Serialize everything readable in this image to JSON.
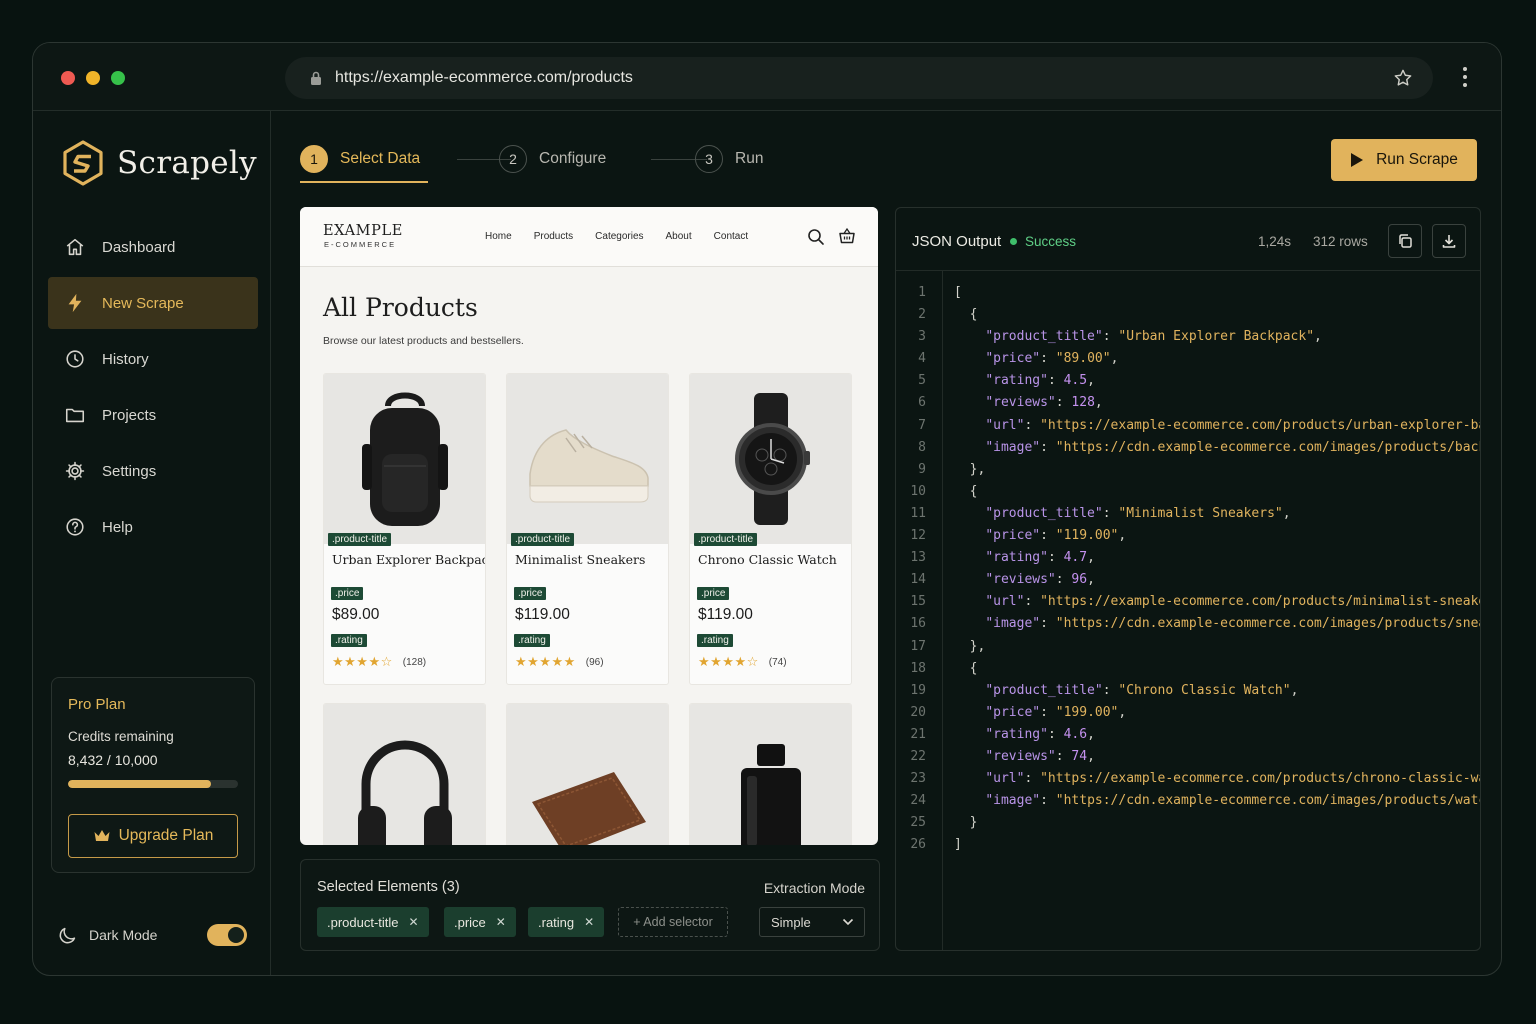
{
  "browser": {
    "url": "https://example-ecommerce.com/products"
  },
  "app": {
    "name": "Scrapely"
  },
  "sidebar": {
    "items": [
      {
        "label": "Dashboard",
        "icon": "home-icon"
      },
      {
        "label": "New Scrape",
        "icon": "bolt-icon",
        "active": true
      },
      {
        "label": "History",
        "icon": "clock-icon"
      },
      {
        "label": "Projects",
        "icon": "folder-icon"
      },
      {
        "label": "Settings",
        "icon": "gear-icon"
      },
      {
        "label": "Help",
        "icon": "help-icon"
      }
    ],
    "plan": {
      "title": "Pro Plan",
      "credits_label": "Credits remaining",
      "credits_value": "8,432 / 10,000",
      "credits_fraction": 0.8432,
      "upgrade_label": "Upgrade Plan"
    },
    "dark_mode": {
      "label": "Dark Mode",
      "on": true
    }
  },
  "steps": [
    {
      "num": "1",
      "label": "Select Data",
      "active": true
    },
    {
      "num": "2",
      "label": "Configure"
    },
    {
      "num": "3",
      "label": "Run"
    }
  ],
  "run_button": "Run Scrape",
  "preview": {
    "brand": "EXAMPLE",
    "brand_sub": "E-COMMERCE",
    "nav": [
      "Home",
      "Products",
      "Categories",
      "About",
      "Contact"
    ],
    "title": "All Products",
    "subtitle": "Browse our latest products and bestsellers.",
    "tags": {
      "title": ".product-title",
      "price": ".price",
      "rating": ".rating"
    },
    "products": [
      {
        "name": "Urban Explorer Backpack",
        "price": "$89.00",
        "reviews": "(128)",
        "rating": 4.5,
        "image": "backpack"
      },
      {
        "name": "Minimalist Sneakers",
        "price": "$119.00",
        "reviews": "(96)",
        "rating": 4.7,
        "image": "sneaker"
      },
      {
        "name": "Chrono Classic Watch",
        "price": "$119.00",
        "reviews": "(74)",
        "rating": 4.6,
        "image": "watch"
      }
    ],
    "more_products": [
      "headphones",
      "wallet",
      "perfume"
    ]
  },
  "selection": {
    "title": "Selected Elements (3)",
    "chips": [
      ".product-title",
      ".price",
      ".rating"
    ],
    "add_label": "+ Add selector",
    "mode_label": "Extraction Mode",
    "mode_value": "Simple"
  },
  "json_panel": {
    "title": "JSON Output",
    "status": "Success",
    "time": "1,24s",
    "rows": "312 rows",
    "colors": {
      "key": "#b994e8",
      "string": "#e0b35e",
      "status": "#5fcf86"
    },
    "records": [
      {
        "product_title": "Urban Explorer Backpack",
        "price": "89.00",
        "rating": "4.5",
        "reviews": "128",
        "url": "https://example-ecommerce.com/products/urban-explorer-backpack",
        "image": "https://cdn.example-ecommerce.com/images/products/backpack.jpg"
      },
      {
        "product_title": "Minimalist Sneakers",
        "price": "119.00",
        "rating": "4.7",
        "reviews": "96",
        "url": "https://example-ecommerce.com/products/minimalist-sneakers",
        "image": "https://cdn.example-ecommerce.com/images/products/sneakers.jpg"
      },
      {
        "product_title": "Chrono Classic Watch",
        "price": "199.00",
        "rating": "4.6",
        "reviews": "74",
        "url": "https://example-ecommerce.com/products/chrono-classic-watch",
        "image": "https://cdn.example-ecommerce.com/images/products/watch.jpg"
      }
    ]
  }
}
